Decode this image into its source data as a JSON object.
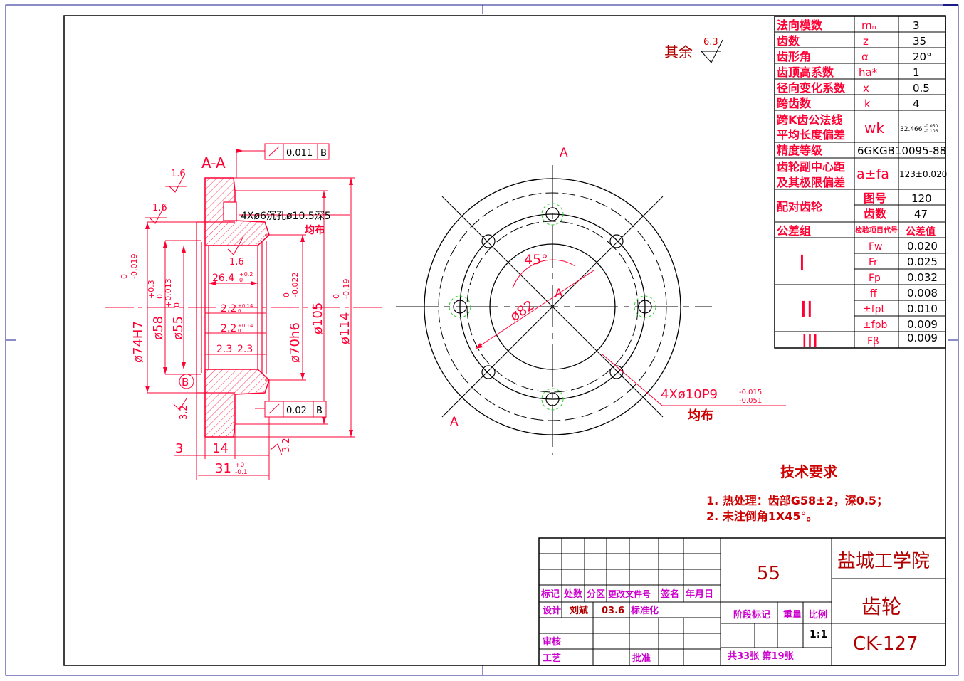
{
  "colors": {
    "frame": "#000000",
    "dimension": "#ff0033",
    "frame_outer": "#2222aa",
    "title_label": "#cc00cc",
    "title_value": "#b00000",
    "hidden_circle": "#33cc33",
    "hatch": "#ff3355"
  },
  "roughness_note": {
    "label": "其余",
    "value": "6.3"
  },
  "param_table": {
    "rows": [
      {
        "name": "法向模数",
        "symbol": "mₙ",
        "value": "3"
      },
      {
        "name": "齿数",
        "symbol": "z",
        "value": "35"
      },
      {
        "name": "齿形角",
        "symbol": "α",
        "value": "20°"
      },
      {
        "name": "齿顶高系数",
        "symbol": "ha*",
        "value": "1"
      },
      {
        "name": "径向变化系数",
        "symbol": "x",
        "value": "0.5"
      },
      {
        "name": "跨齿数",
        "symbol": "k",
        "value": "4"
      }
    ],
    "wk": {
      "name1": "跨K齿公法线",
      "name2": "平均长度偏差",
      "symbol": "wk",
      "value": "32.466",
      "dev_upper": "-0.050",
      "dev_lower": "-0.106"
    },
    "accuracy": {
      "name": "精度等级",
      "value": "6GKGB10095-88"
    },
    "center": {
      "name1": "齿轮副中心距",
      "name2": "及其极限偏差",
      "symbol": "a±fa",
      "value": "123±0.020"
    },
    "mating": {
      "name": "配对齿轮",
      "drawing_label": "图号",
      "drawing_value": "120",
      "teeth_label": "齿数",
      "teeth_value": "47"
    },
    "tolerance_header": {
      "group": "公差组",
      "code": "检验项目代号",
      "value": "公差值"
    },
    "groups": [
      {
        "roman": "I",
        "items": [
          {
            "code": "Fw",
            "value": "0.020"
          },
          {
            "code": "Fr",
            "value": "0.025"
          },
          {
            "code": "Fp",
            "value": "0.032"
          }
        ]
      },
      {
        "roman": "II",
        "items": [
          {
            "code": "ff",
            "value": "0.008"
          },
          {
            "code": "±fpt",
            "value": "0.010"
          },
          {
            "code": "±fpb",
            "value": "0.009"
          }
        ]
      },
      {
        "roman": "III",
        "items": [
          {
            "code": "Fβ",
            "value": "0.009"
          }
        ]
      }
    ]
  },
  "section_view": {
    "title": "A-A",
    "tolerance_top": {
      "symbol": "↗",
      "value": "0.011",
      "datum": "B"
    },
    "tolerance_bottom": {
      "symbol": "↗",
      "value": "0.02",
      "datum": "B"
    },
    "datum": "B",
    "hole_note_1": "4Xø6沉孔ø10.5深5",
    "hole_note_2": "均布",
    "roughness_1": "1.6",
    "roughness_2": "1.6",
    "roughness_3": "1.6",
    "roughness_4": "3.2",
    "roughness_5": "3.2",
    "dim_d74": "ø74H7",
    "dim_d74_tol_upper": "0",
    "dim_d74_tol_lower": "-0.019",
    "dim_d58": "ø58",
    "dim_d58_tol_upper": "+0.3",
    "dim_d58_tol_lower": "0",
    "dim_d55": "ø55",
    "dim_d55_tol_upper": "+0.013",
    "dim_d55_tol_lower": "0",
    "dim_d70": "ø70h6",
    "dim_d70_tol_upper": "0",
    "dim_d70_tol_lower": "-0.022",
    "dim_d105": "ø105",
    "dim_d114": "ø114",
    "dim_d114_tol_upper": "0",
    "dim_d114_tol_lower": "-0.19",
    "dim_26": "26.4",
    "dim_26_tol_upper": "+0.2",
    "dim_26_tol_lower": "0",
    "dim_22a": "2.2",
    "dim_22a_tol_upper": "+0.14",
    "dim_22a_tol_lower": "0",
    "dim_22b": "2.2",
    "dim_22b_tol_upper": "+0.14",
    "dim_22b_tol_lower": "0",
    "dim_23a": "2.3",
    "dim_23b": "2.3",
    "dim_3": "3",
    "dim_14": "14",
    "dim_31": "31",
    "dim_31_tol_upper": "+0",
    "dim_31_tol_lower": "-0.1"
  },
  "front_view": {
    "cut_label": "A",
    "center_label": "A",
    "angle": "45°",
    "dia_82": "ø82",
    "hole_note_1": "4Xø10P9",
    "hole_tol_upper": "-0.015",
    "hole_tol_lower": "-0.051",
    "hole_note_2": "均布"
  },
  "tech_req": {
    "title": "技术要求",
    "items": [
      "1. 热处理：齿部G58±2，深0.5；",
      "2. 未注倒角1X45°。"
    ]
  },
  "title_block": {
    "school": "盐城工学院",
    "part_name": "齿轮",
    "drawing_no": "CK-127",
    "material": "55",
    "header_labels": [
      "标记",
      "处数",
      "分区",
      "更改文件号",
      "签名",
      "年月日"
    ],
    "design_label": "设计",
    "designer": "刘斌",
    "date": "03.6",
    "standard_label": "标准化",
    "stage_label": "阶段标记",
    "weight_label": "重量",
    "scale_label": "比例",
    "scale": "1:1",
    "review_label": "审核",
    "process_label": "工艺",
    "approve_label": "批准",
    "sheets": "共33张 第19张"
  }
}
